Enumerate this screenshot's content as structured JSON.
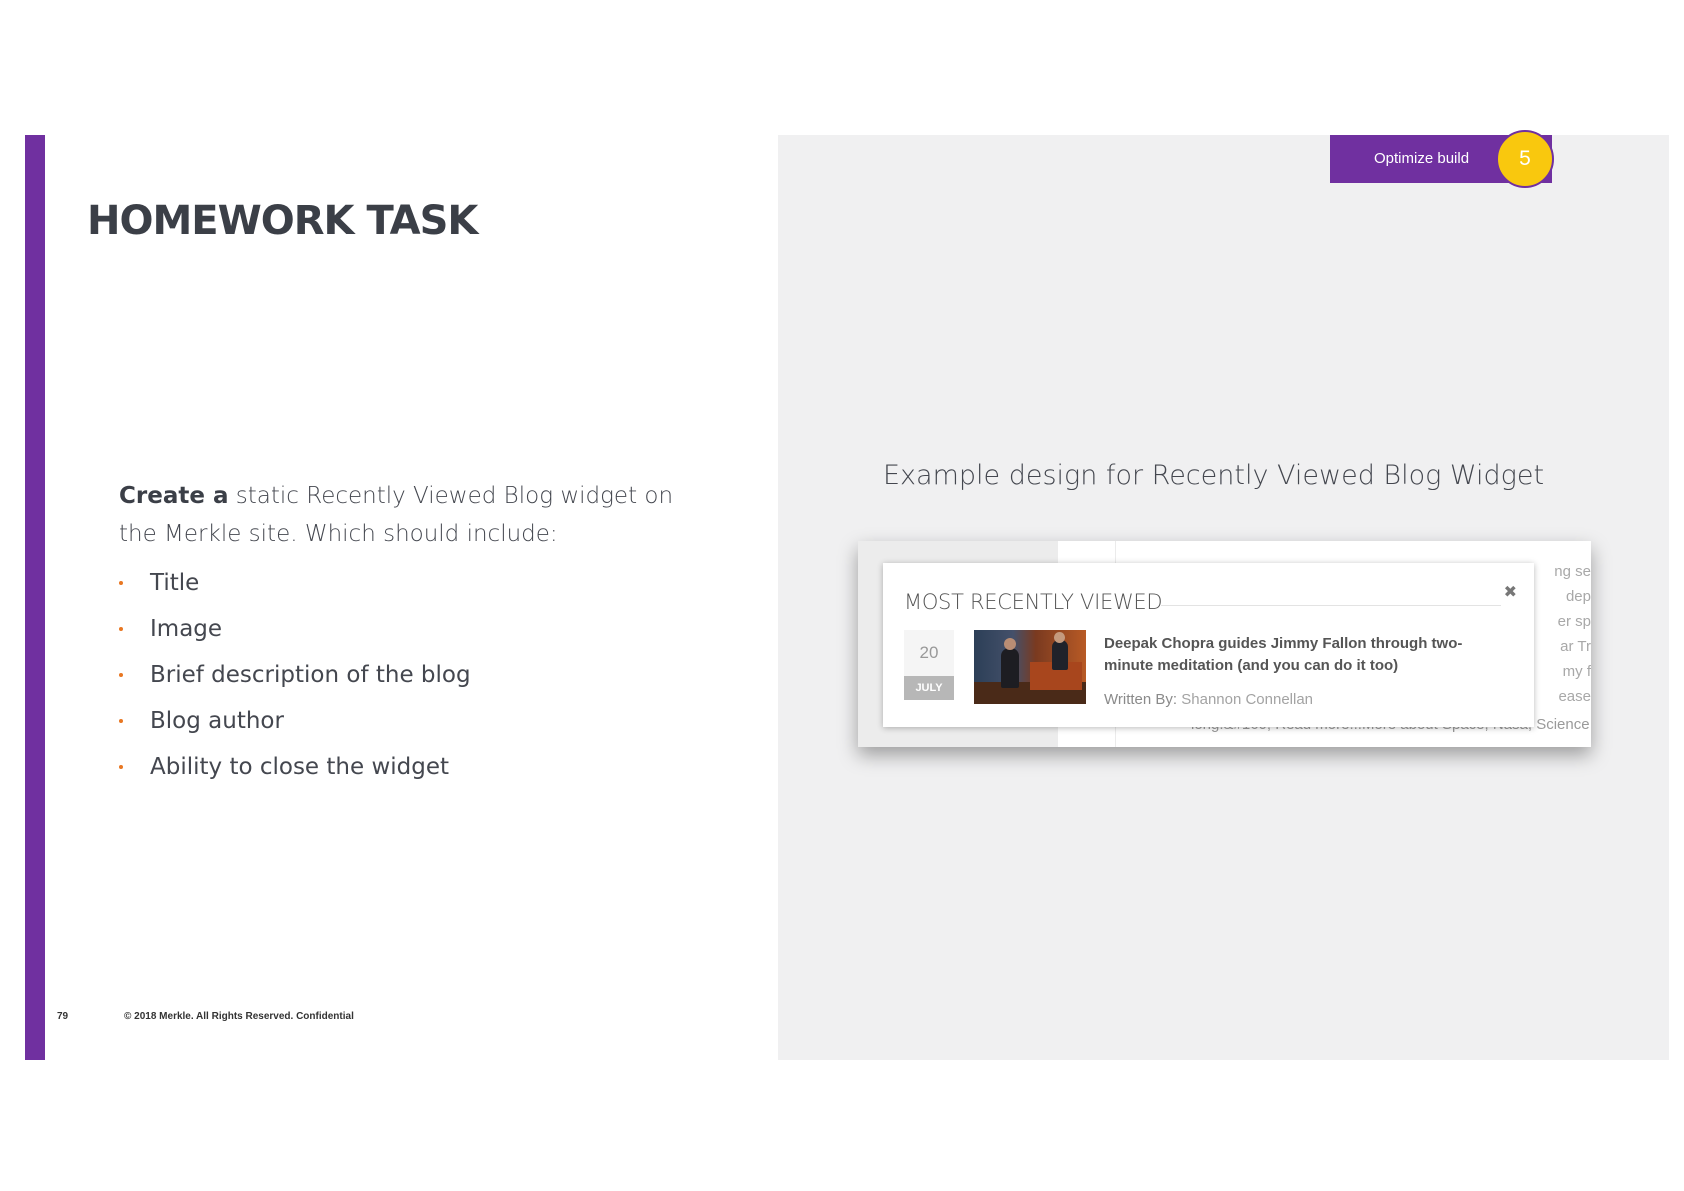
{
  "slide": {
    "title": "HOMEWORK TASK",
    "intro_bold": "Create a",
    "intro_rest": " static Recently Viewed Blog widget on the Merkle site.  Which should include:",
    "bullets": [
      "Title",
      "Image",
      "Brief description of the blog",
      "Blog author",
      "Ability to close the widget"
    ],
    "page_number": "79",
    "copyright": "© 2018 Merkle. All Rights Reserved. Confidential"
  },
  "badge": {
    "label": "Optimize build",
    "number": "5"
  },
  "example": {
    "caption": "Example design for Recently Viewed Blog Widget",
    "background_fragments": [
      "ng se",
      "dep",
      "er sp",
      "ar Tr",
      "my f",
      "ease"
    ],
    "background_bottom": "long.&#160; Read more...More about Space, Nasa, Science",
    "widget": {
      "title": "MOST RECENTLY VIEWED",
      "close_icon": "✖",
      "date_day": "20",
      "date_month": "JULY",
      "headline": "Deepak Chopra guides Jimmy Fallon through two-minute meditation (and you can do it too)",
      "author_label": "Written By: ",
      "author_name": "Shannon Connellan"
    }
  },
  "colors": {
    "accent": "#7030a0",
    "badge_circle": "#f9c80e",
    "bullet": "#e87722",
    "panel": "#f0f0f1"
  }
}
